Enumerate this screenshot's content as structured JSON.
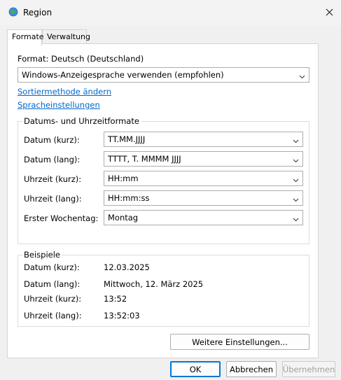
{
  "window": {
    "title": "Region",
    "icons": {
      "app": "globe-region-icon",
      "close": "close-icon",
      "dropdown": "chevron-down-icon"
    }
  },
  "tabs": [
    {
      "label": "Formate",
      "active": true
    },
    {
      "label": "Verwaltung",
      "active": false
    }
  ],
  "format": {
    "heading": "Format: Deutsch (Deutschland)",
    "selected": "Windows-Anzeigesprache verwenden (empfohlen)"
  },
  "links": {
    "sort": "Sortiermethode ändern",
    "language": "Spracheinstellungen"
  },
  "formats_group": {
    "title": "Datums- und Uhrzeitformate",
    "rows": [
      {
        "label": "Datum (kurz):",
        "value": "TT.MM.JJJJ"
      },
      {
        "label": "Datum (lang):",
        "value": "TTTT, T. MMMM JJJJ"
      },
      {
        "label": "Uhrzeit (kurz):",
        "value": "HH:mm"
      },
      {
        "label": "Uhrzeit (lang):",
        "value": "HH:mm:ss"
      },
      {
        "label": "Erster Wochentag:",
        "value": "Montag"
      }
    ]
  },
  "examples_group": {
    "title": "Beispiele",
    "rows": [
      {
        "label": "Datum (kurz):",
        "value": "12.03.2025"
      },
      {
        "label": "Datum (lang):",
        "value": "Mittwoch, 12. März 2025"
      },
      {
        "label": "Uhrzeit (kurz):",
        "value": "13:52"
      },
      {
        "label": "Uhrzeit (lang):",
        "value": "13:52:03"
      }
    ]
  },
  "buttons": {
    "more_settings": "Weitere Einstellungen...",
    "ok": "OK",
    "cancel": "Abbrechen",
    "apply": "Übernehmen"
  },
  "colors": {
    "link": "#0066cc",
    "accent": "#0078d4",
    "disabled_text": "#a0a0a0"
  }
}
